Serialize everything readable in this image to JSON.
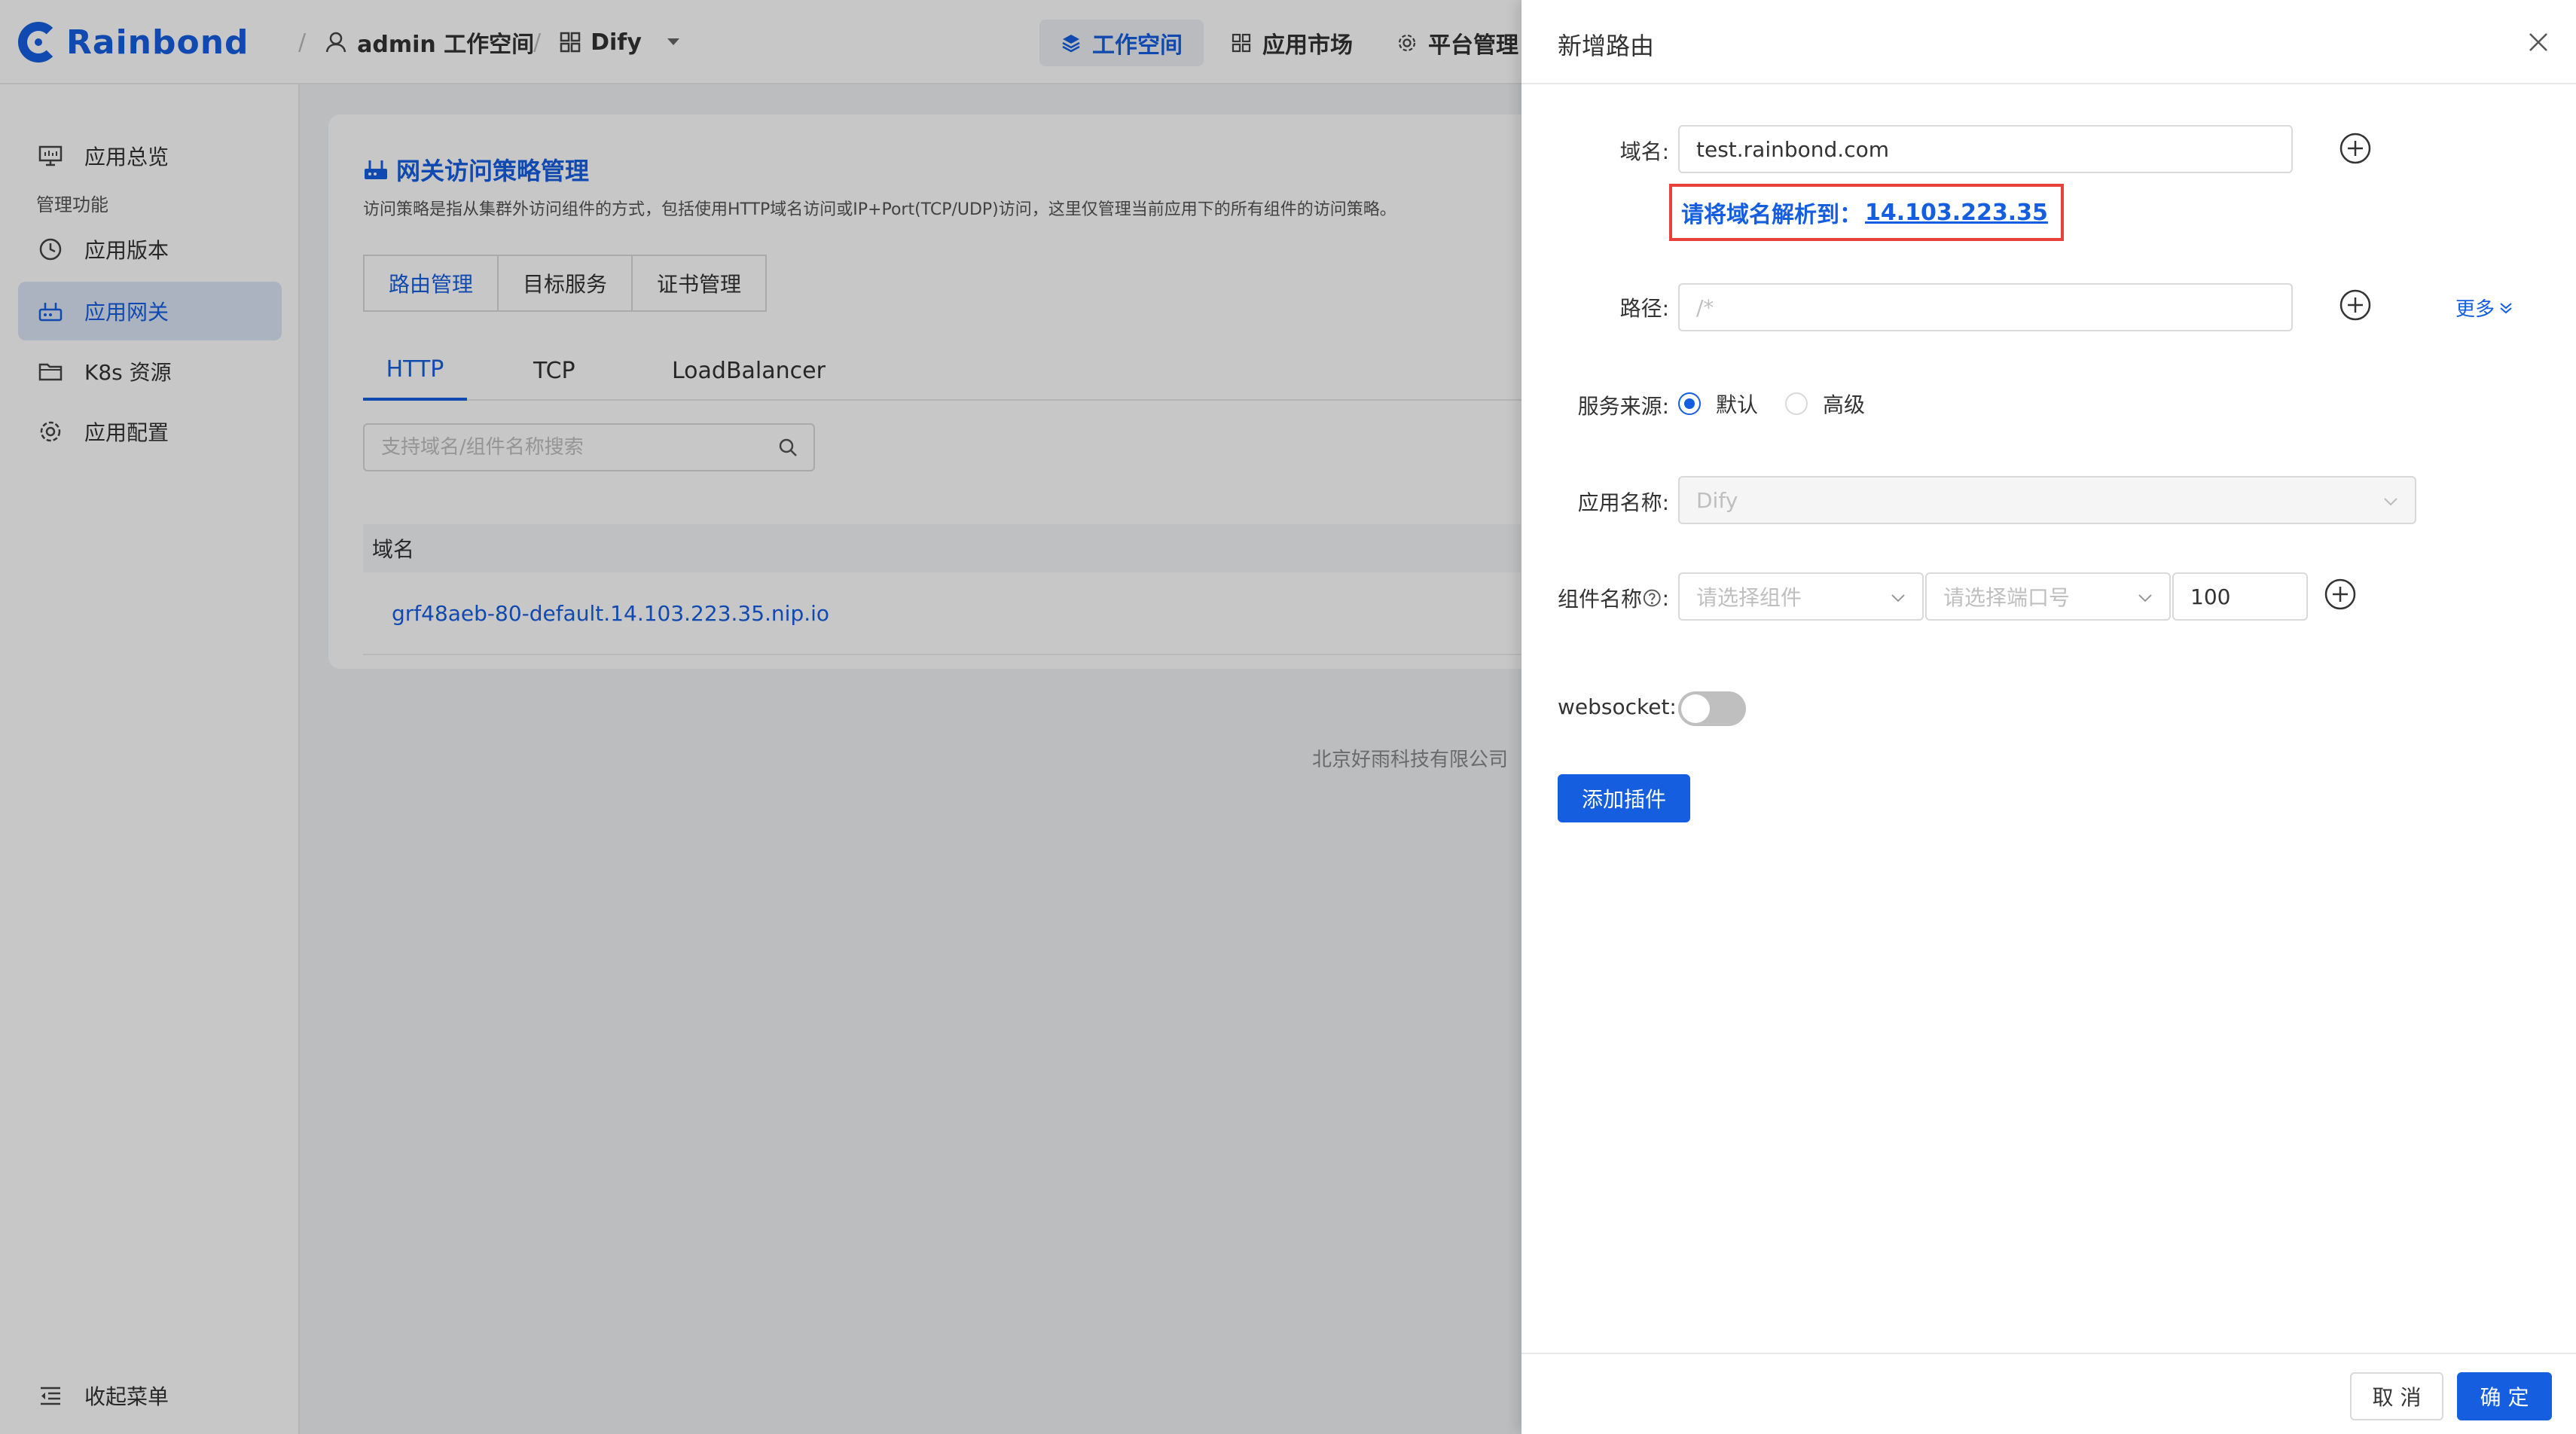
{
  "app": {
    "logo_text": "Rainbond",
    "brand_color": "#155ee0"
  },
  "breadcrumb": {
    "workspace": "admin 工作空间",
    "app": "Dify",
    "separator": "/"
  },
  "top_nav": {
    "workspace": "工作空间",
    "market": "应用市场",
    "platform": "平台管理"
  },
  "sidebar": {
    "overview": "应用总览",
    "group_label": "管理功能",
    "items": [
      "应用版本",
      "应用网关",
      "K8s 资源",
      "应用配置"
    ],
    "active": "应用网关",
    "collapse": "收起菜单"
  },
  "card": {
    "title": "网关访问策略管理",
    "description": "访问策略是指从集群外访问组件的方式，包括使用HTTP域名访问或IP+Port(TCP/UDP)访问，这里仅管理当前应用下的所有组件的访问策略。",
    "button_tabs": [
      "路由管理",
      "目标服务",
      "证书管理"
    ],
    "line_tabs": [
      "HTTP",
      "TCP",
      "LoadBalancer"
    ],
    "search_placeholder": "支持域名/组件名称搜索",
    "table_header_domain": "域名",
    "rows": [
      "grf48aeb-80-default.14.103.223.35.nip.io"
    ]
  },
  "footer": {
    "company": "北京好雨科技有限公司"
  },
  "drawer": {
    "title": "新增路由",
    "domain_label": "域名:",
    "domain_value": "test.rainbond.com",
    "hint_prefix": "请将域名解析到：",
    "hint_ip": "14.103.223.35",
    "path_label": "路径:",
    "path_placeholder": "/*",
    "more_label": "更多",
    "source_label": "服务来源:",
    "source_options": [
      "默认",
      "高级"
    ],
    "source_selected": "默认",
    "appname_label": "应用名称:",
    "appname_value": "Dify",
    "component_label": "组件名称",
    "component_placeholder": "请选择组件",
    "port_placeholder": "请选择端口号",
    "weight_value": "100",
    "websocket_label": "websocket:",
    "websocket_on": false,
    "add_plugin": "添加插件",
    "cancel": "取 消",
    "confirm": "确 定",
    "hint_border_color": "#e8413c"
  }
}
